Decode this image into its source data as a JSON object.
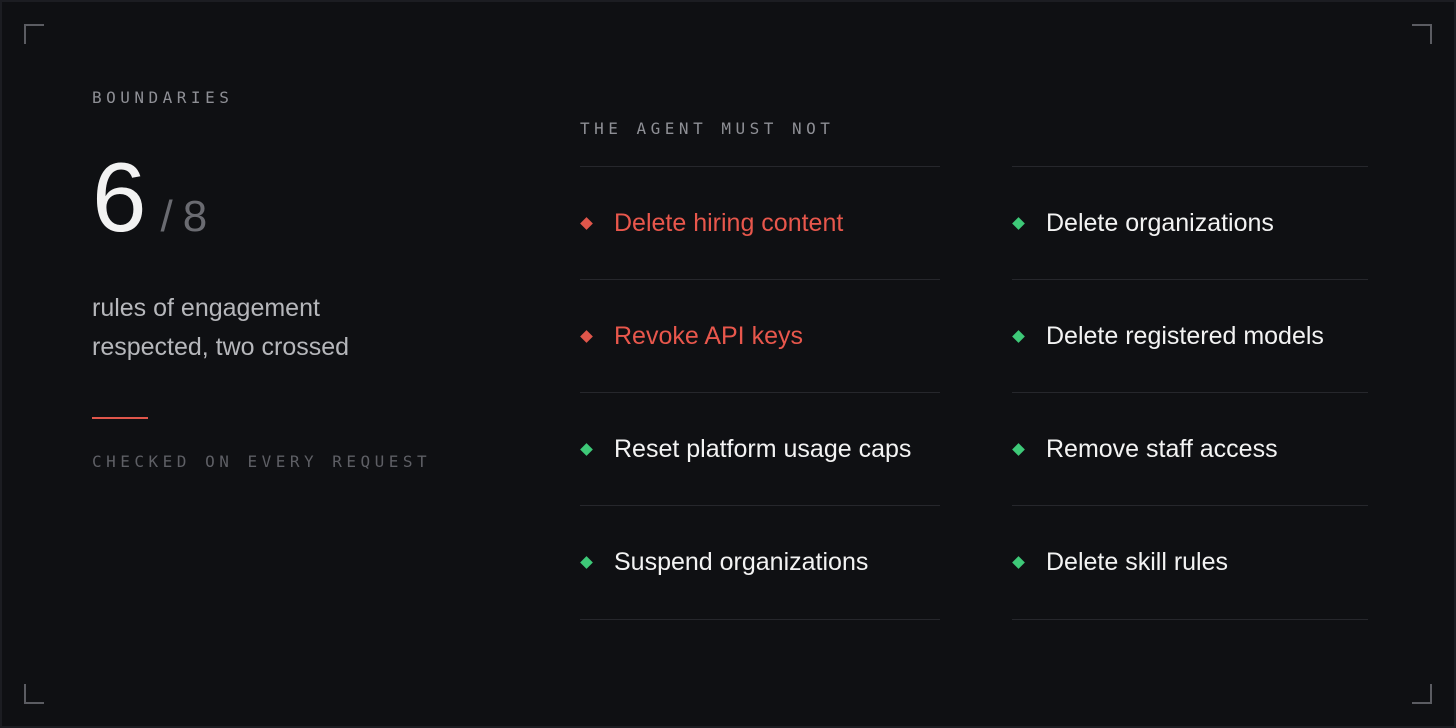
{
  "summary": {
    "eyebrow": "BOUNDARIES",
    "respected": "6",
    "separator": "/",
    "total": "8",
    "caption_line1": "rules of engagement",
    "caption_line2": "respected, two crossed",
    "footnote": "CHECKED ON EVERY REQUEST"
  },
  "rules": {
    "title": "THE AGENT MUST NOT",
    "left": [
      {
        "label": "Delete hiring content",
        "status": "crossed"
      },
      {
        "label": "Revoke API keys",
        "status": "crossed"
      },
      {
        "label": "Reset platform usage caps",
        "status": "respected"
      },
      {
        "label": "Suspend organizations",
        "status": "respected"
      }
    ],
    "right": [
      {
        "label": "Delete organizations",
        "status": "respected"
      },
      {
        "label": "Delete registered models",
        "status": "respected"
      },
      {
        "label": "Remove staff access",
        "status": "respected"
      },
      {
        "label": "Delete skill rules",
        "status": "respected"
      }
    ]
  },
  "colors": {
    "background": "#0f1013",
    "respected": "#3ec978",
    "crossed": "#e0564b",
    "text": "#f3f3f3"
  }
}
